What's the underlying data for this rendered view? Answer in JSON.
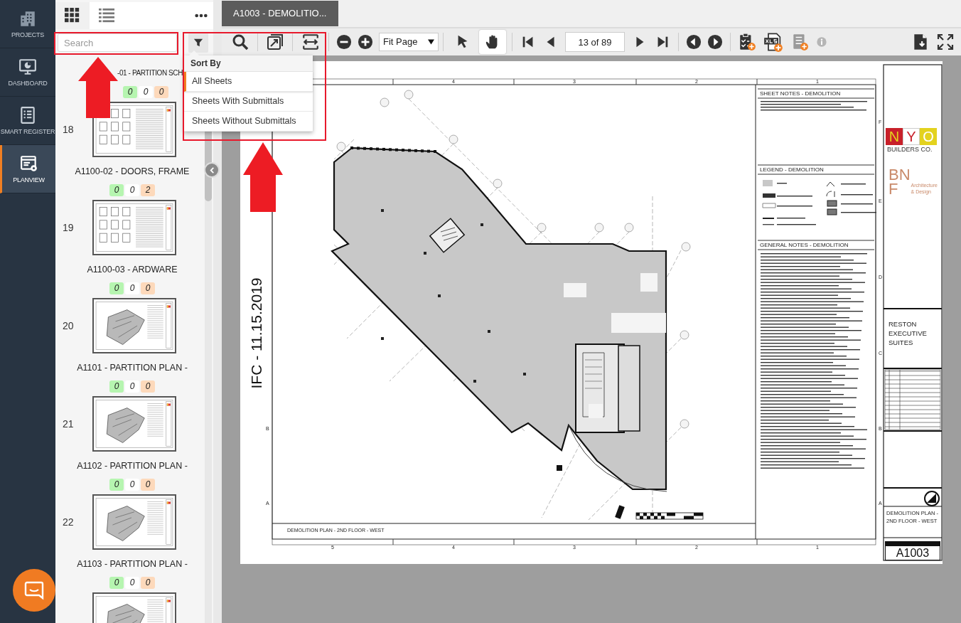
{
  "nav": {
    "items": [
      {
        "label": "PROJECTS",
        "selected": false
      },
      {
        "label": "DASHBOARD",
        "selected": false
      },
      {
        "label": "SMART REGISTER",
        "selected": false
      },
      {
        "label": "PLANVIEW",
        "selected": true
      }
    ]
  },
  "sheet_panel": {
    "view_toggle": [
      {
        "kind": "grid",
        "selected": true
      },
      {
        "kind": "list",
        "selected": false
      }
    ],
    "search": {
      "placeholder": "Search"
    },
    "sort_menu": {
      "title": "Sort By",
      "options": [
        {
          "label": "All Sheets",
          "selected": true
        },
        {
          "label": "Sheets With Submittals",
          "selected": false
        },
        {
          "label": "Sheets Without Submittals",
          "selected": false
        }
      ]
    },
    "sheets": [
      {
        "kind": "label_only",
        "label": "-01 - PARTITION SCH",
        "counts": [
          "0",
          "0",
          "0"
        ]
      },
      {
        "kind": "full",
        "number": "18",
        "label": "A1100-02 - DOORS, FRAME",
        "counts": [
          "0",
          "0",
          "2"
        ]
      },
      {
        "kind": "full",
        "number": "19",
        "label": "A1100-03 - ARDWARE",
        "counts": [
          "0",
          "0",
          "0"
        ]
      },
      {
        "kind": "full",
        "number": "20",
        "label": "A1101 - PARTITION PLAN -",
        "counts": [
          "0",
          "0",
          "0"
        ]
      },
      {
        "kind": "full",
        "number": "21",
        "label": "A1102 - PARTITION PLAN -",
        "counts": [
          "0",
          "0",
          "0"
        ]
      },
      {
        "kind": "full",
        "number": "22",
        "label": "A1103 - PARTITION PLAN -",
        "counts": [
          "0",
          "0",
          "0"
        ]
      },
      {
        "kind": "thumb_only"
      }
    ]
  },
  "tabs": [
    {
      "label": "A1003 - DEMOLITIO...",
      "selected": true
    }
  ],
  "toolbar": {
    "zoom_mode": "Fit Page",
    "page": "13 of 89",
    "tools": [
      {
        "kind": "pointer",
        "selected": false
      },
      {
        "kind": "hand",
        "selected": true
      }
    ]
  },
  "document": {
    "stamp": "IFC - 11.15.2019",
    "sections": [
      "SHEET NOTES  - DEMOLITION",
      "LEGEND - DEMOLITION",
      "GENERAL NOTES - DEMOLITION"
    ],
    "logo_1": {
      "letters": [
        "N",
        "Y",
        "O"
      ],
      "caption": "BUILDERS CO."
    },
    "logo_2": {
      "mark_top": "BN",
      "mark_bottom": "F",
      "caption": [
        "Architecture",
        "& Design"
      ]
    },
    "project": [
      "RESTON",
      "EXECUTIVE",
      "SUITES"
    ],
    "sheet_title": "DEMOLITION PLAN - 2ND FLOOR - WEST",
    "sheet_number": "A1003",
    "plan_caption": "DEMOLITION PLAN - 2ND FLOOR - WEST",
    "top_columns": [
      "4",
      "3",
      "2",
      "1"
    ],
    "bottom_columns": [
      "5",
      "4",
      "3",
      "2",
      "1"
    ],
    "right_rows": [
      "F",
      "E",
      "D",
      "C",
      "B",
      "A"
    ],
    "left_rows": [
      "B",
      "A"
    ]
  }
}
